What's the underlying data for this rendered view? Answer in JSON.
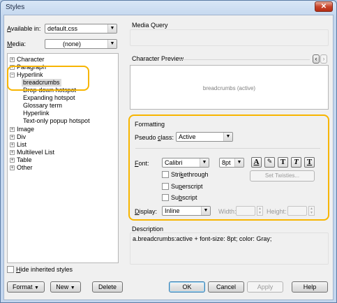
{
  "window": {
    "title": "Styles",
    "close_glyph": "✕"
  },
  "available_in": {
    "label_prefix": "",
    "label_key": "A",
    "label_rest": "vailable in:",
    "value": "default.css"
  },
  "media": {
    "label_key": "M",
    "label_rest": "edia:",
    "value": "(none)"
  },
  "tree": {
    "items": [
      {
        "label": "Character",
        "expander": "+"
      },
      {
        "label": "Paragraph",
        "expander": "+"
      },
      {
        "label": "Hyperlink",
        "expander": "−"
      },
      {
        "label": "breadcrumbs"
      },
      {
        "label": "Drop-down hotspot"
      },
      {
        "label": "Expanding hotspot"
      },
      {
        "label": "Glossary term"
      },
      {
        "label": "Hyperlink"
      },
      {
        "label": "Text-only popup hotspot"
      },
      {
        "label": "Image",
        "expander": "+"
      },
      {
        "label": "Div",
        "expander": "+"
      },
      {
        "label": "List",
        "expander": "+"
      },
      {
        "label": "Multilevel List",
        "expander": "+"
      },
      {
        "label": "Table",
        "expander": "+"
      },
      {
        "label": "Other",
        "expander": "+"
      }
    ]
  },
  "hide_inherited": {
    "label_key": "H",
    "label_rest": "ide inherited styles",
    "checked": false
  },
  "media_query": {
    "title": "Media Query"
  },
  "character_preview": {
    "title": "Character Preview",
    "sample": "breadcrumbs (active)",
    "prev_glyph": "‹",
    "next_glyph": "›"
  },
  "formatting": {
    "title": "Formatting",
    "pseudo_class": {
      "label_key": "c",
      "label_before": "Pseudo ",
      "label_after": "lass:",
      "value": "Active"
    },
    "font": {
      "label_key": "F",
      "label_rest": "ont:",
      "value": "Calibri",
      "size": "8pt"
    },
    "style_buttons": [
      "A",
      "T",
      "T",
      "T"
    ],
    "checkboxes": [
      {
        "label_before": "Stri",
        "label_key": "k",
        "label_after": "ethrough"
      },
      {
        "label_before": "Su",
        "label_key": "p",
        "label_after": "erscript"
      },
      {
        "label_before": "Su",
        "label_key": "b",
        "label_after": "script"
      }
    ],
    "set_twisties_label": "Set Twisties...",
    "display": {
      "label_key": "D",
      "label_rest": "isplay:",
      "value": "Inline"
    },
    "width_label": "Width:",
    "height_label": "Height:"
  },
  "description": {
    "title": "Description",
    "text": "a.breadcrumbs:active + font-size: 8pt;  color: Gray;"
  },
  "footer": {
    "format_label": "Format",
    "new_label": "New",
    "delete_label": "Delete",
    "ok_label": "OK",
    "cancel_label": "Cancel",
    "apply_label": "Apply",
    "help_label": "Help"
  },
  "colors": {
    "highlight": "#f7b500",
    "preview_text": "#808080"
  }
}
